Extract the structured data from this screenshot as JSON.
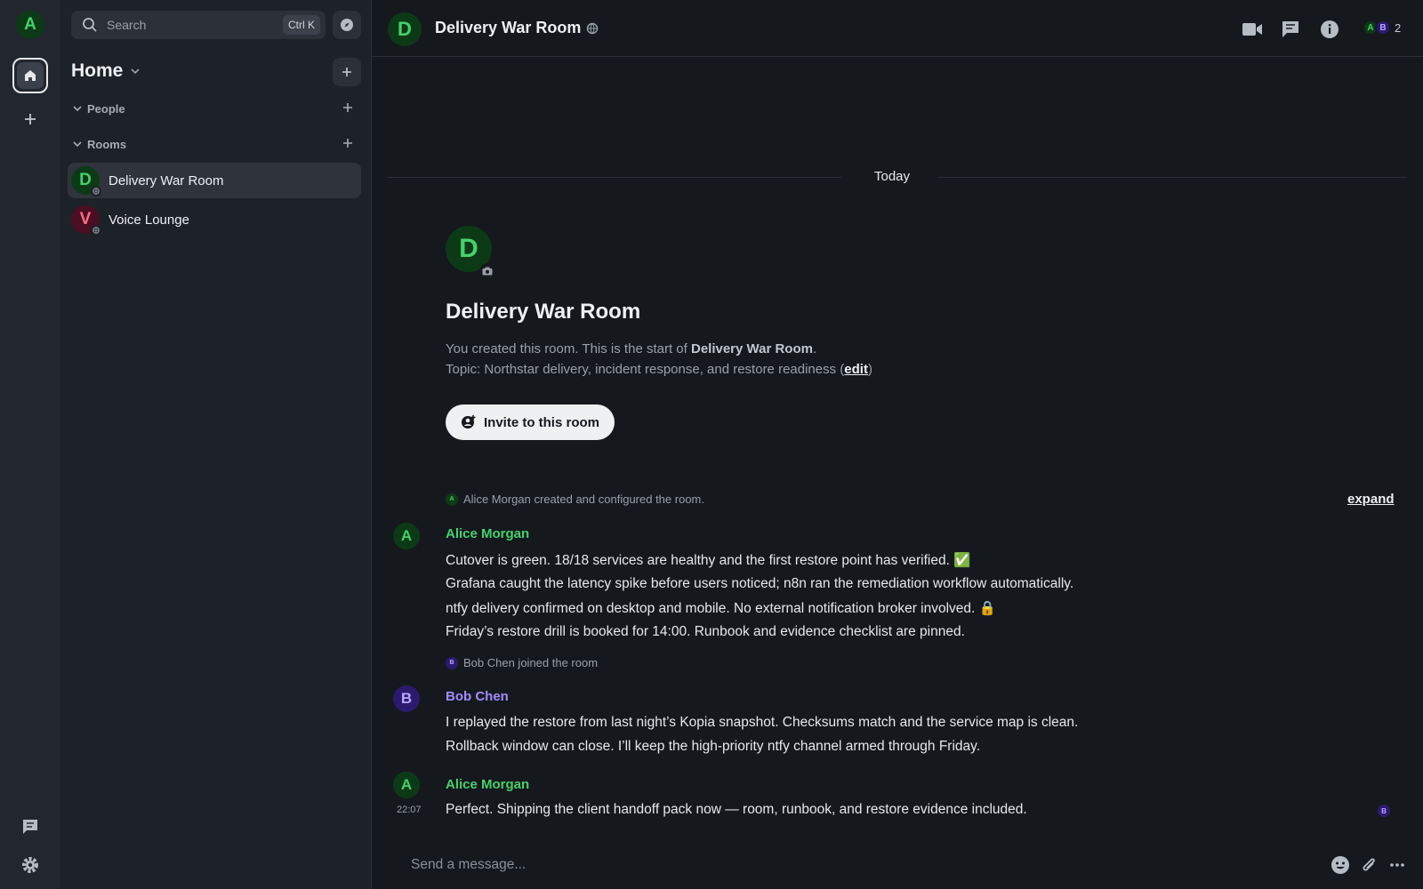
{
  "spacebar": {
    "avatar_letter": "A"
  },
  "roomlist": {
    "search_label": "Search",
    "search_shortcut": "Ctrl K",
    "home_title": "Home",
    "sections": {
      "people": "People",
      "rooms": "Rooms"
    },
    "rooms": [
      {
        "letter": "D",
        "name": "Delivery War Room",
        "active": true,
        "color": "#45d16b",
        "bg": "#0d3a16"
      },
      {
        "letter": "V",
        "name": "Voice Lounge",
        "active": false,
        "color": "#ff6b8a",
        "bg": "#4a0f22"
      }
    ]
  },
  "header": {
    "room_letter": "D",
    "room_name": "Delivery War Room",
    "members": [
      "A",
      "B"
    ],
    "member_count": "2"
  },
  "timeline": {
    "date_separator": "Today",
    "intro": {
      "avatar_letter": "D",
      "title": "Delivery War Room",
      "created_prefix": "You created this room. This is the start of ",
      "created_room": "Delivery War Room",
      "created_suffix": ".",
      "topic_prefix": "Topic: Northstar delivery, incident response, and restore readiness (",
      "topic_edit": "edit",
      "topic_suffix": ")",
      "invite_label": "Invite to this room"
    },
    "events": {
      "created": {
        "avatar": "A",
        "text": "Alice Morgan created and configured the room.",
        "expand": "expand"
      },
      "joined": {
        "avatar": "B",
        "text": "Bob Chen joined the room"
      }
    },
    "messages": {
      "alice1": {
        "avatar": "A",
        "sender": "Alice Morgan",
        "lines": [
          "Cutover is green. 18/18 services are healthy and the first restore point has verified. ✅",
          "Grafana caught the latency spike before users noticed; n8n ran the remediation workflow automatically.",
          "ntfy delivery confirmed on desktop and mobile. No external notification broker involved. 🔒",
          "Friday’s restore drill is booked for 14:00. Runbook and evidence checklist are pinned."
        ]
      },
      "bob": {
        "avatar": "B",
        "sender": "Bob Chen",
        "lines": [
          "I replayed the restore from last night’s Kopia snapshot. Checksums match and the service map is clean.",
          "Rollback window can close. I’ll keep the high-priority ntfy channel armed through Friday."
        ]
      },
      "alice2": {
        "avatar": "A",
        "sender": "Alice Morgan",
        "timestamp": "22:07",
        "text": "Perfect. Shipping the client handoff pack now — room, runbook, and restore evidence included.",
        "read_receipt": "B"
      }
    }
  },
  "composer": {
    "placeholder": "Send a message..."
  },
  "colors": {
    "alice": "#45d16b",
    "bob": "#a58bff",
    "bg": "#15191e"
  }
}
